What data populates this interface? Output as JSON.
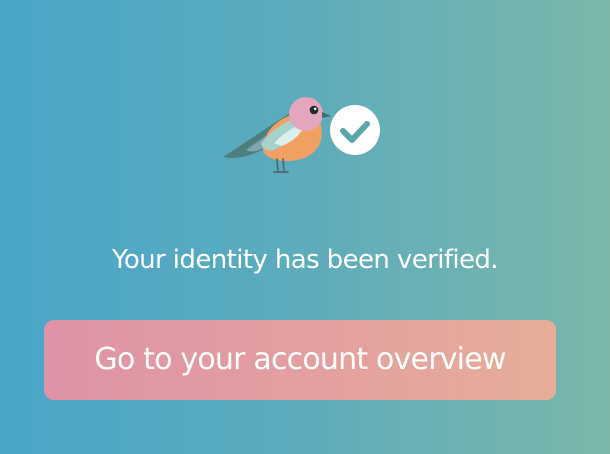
{
  "verification": {
    "illustration_icon": "bird-icon",
    "status_icon": "check-circle-icon",
    "message": "Your identity has been verified.",
    "cta_label": "Go to your account overview"
  },
  "colors": {
    "background_start": "#4aa5c7",
    "background_end": "#7cb7aa",
    "button_start": "#de93a6",
    "button_end": "#e6ae98",
    "text": "#ffffff"
  }
}
